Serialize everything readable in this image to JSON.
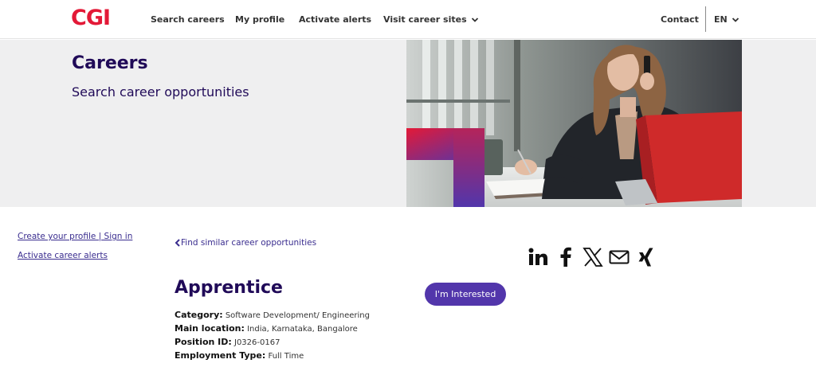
{
  "header": {
    "logo": "CGI",
    "nav": {
      "search_careers": "Search careers",
      "my_profile": "My profile",
      "activate_alerts": "Activate alerts",
      "visit_career_sites": "Visit career sites",
      "contact": "Contact",
      "language": "EN"
    }
  },
  "hero": {
    "title": "Careers",
    "subtitle": "Search career opportunities"
  },
  "sidebar": {
    "create_profile": "Create your profile | Sign in",
    "activate_alerts": "Activate career alerts"
  },
  "job": {
    "back_link": "Find similar career opportunities",
    "title": "Apprentice",
    "interested_button": "I'm Interested",
    "details": [
      {
        "label": "Category:",
        "value": "Software Development/ Engineering"
      },
      {
        "label": "Main location:",
        "value": "India, Karnataka, Bangalore"
      },
      {
        "label": "Position ID:",
        "value": "J0326-0167"
      },
      {
        "label": "Employment Type:",
        "value": "Full Time"
      }
    ]
  },
  "share_icons": [
    "linkedin-icon",
    "facebook-icon",
    "x-twitter-icon",
    "email-icon",
    "xing-icon"
  ],
  "colors": {
    "brand_red": "#e31937",
    "brand_purple": "#5236ab",
    "heading_navy": "#200a58",
    "hero_bg": "#efeff0"
  }
}
